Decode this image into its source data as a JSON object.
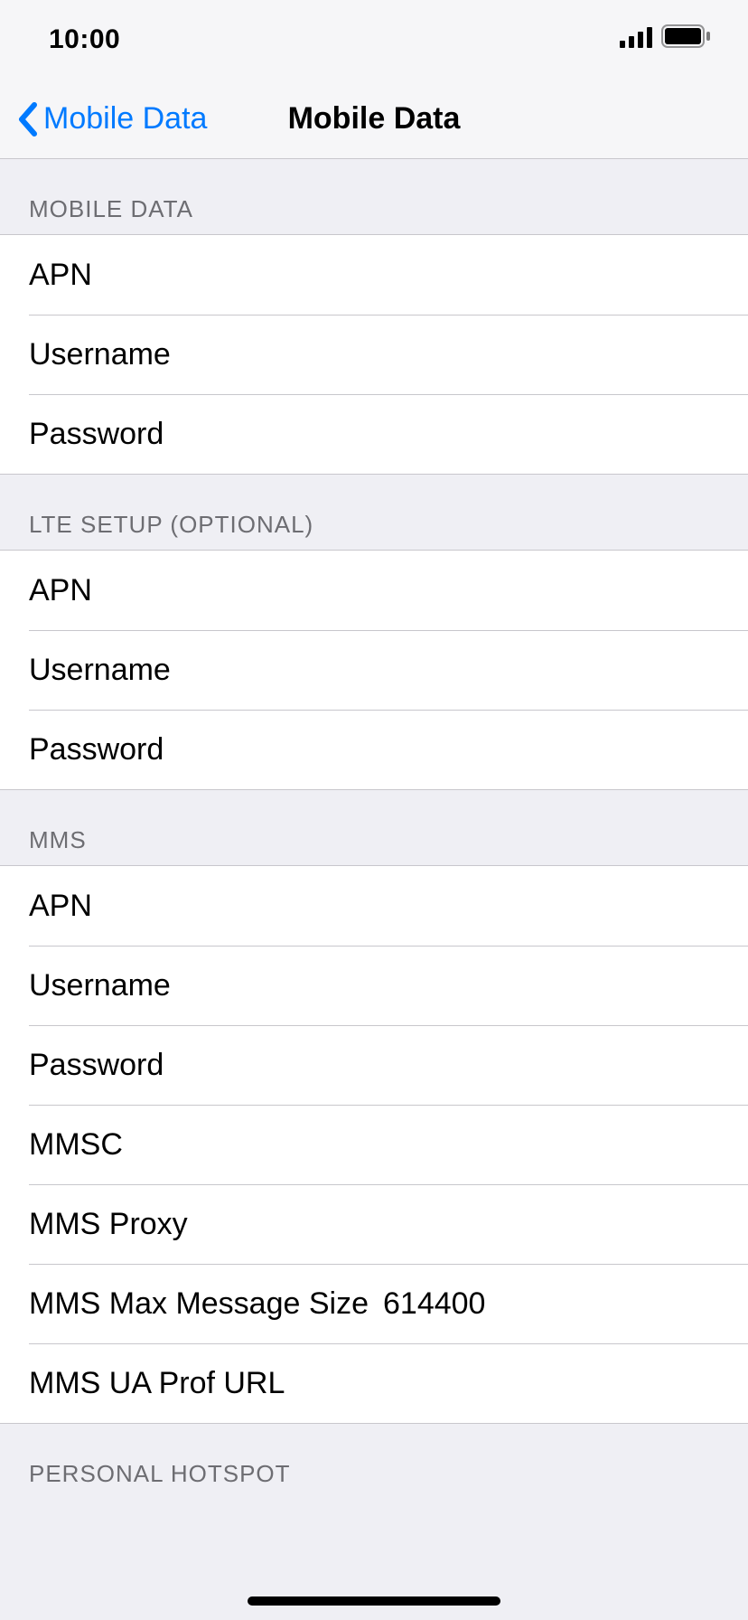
{
  "status": {
    "time": "10:00"
  },
  "nav": {
    "back_label": "Mobile Data",
    "title": "Mobile Data"
  },
  "sections": {
    "mobile_data": {
      "header": "Mobile Data",
      "apn_label": "APN",
      "apn_value": "",
      "user_label": "Username",
      "user_value": "",
      "pass_label": "Password",
      "pass_value": ""
    },
    "lte": {
      "header": "LTE Setup (Optional)",
      "apn_label": "APN",
      "apn_value": "",
      "user_label": "Username",
      "user_value": "",
      "pass_label": "Password",
      "pass_value": ""
    },
    "mms": {
      "header": "MMS",
      "apn_label": "APN",
      "apn_value": "",
      "user_label": "Username",
      "user_value": "",
      "pass_label": "Password",
      "pass_value": "",
      "mmsc_label": "MMSC",
      "mmsc_value": "",
      "proxy_label": "MMS Proxy",
      "proxy_value": "",
      "max_label": "MMS Max Message Size",
      "max_value": "614400",
      "ua_label": "MMS UA Prof URL",
      "ua_value": ""
    },
    "hotspot": {
      "header": "Personal Hotspot"
    }
  }
}
